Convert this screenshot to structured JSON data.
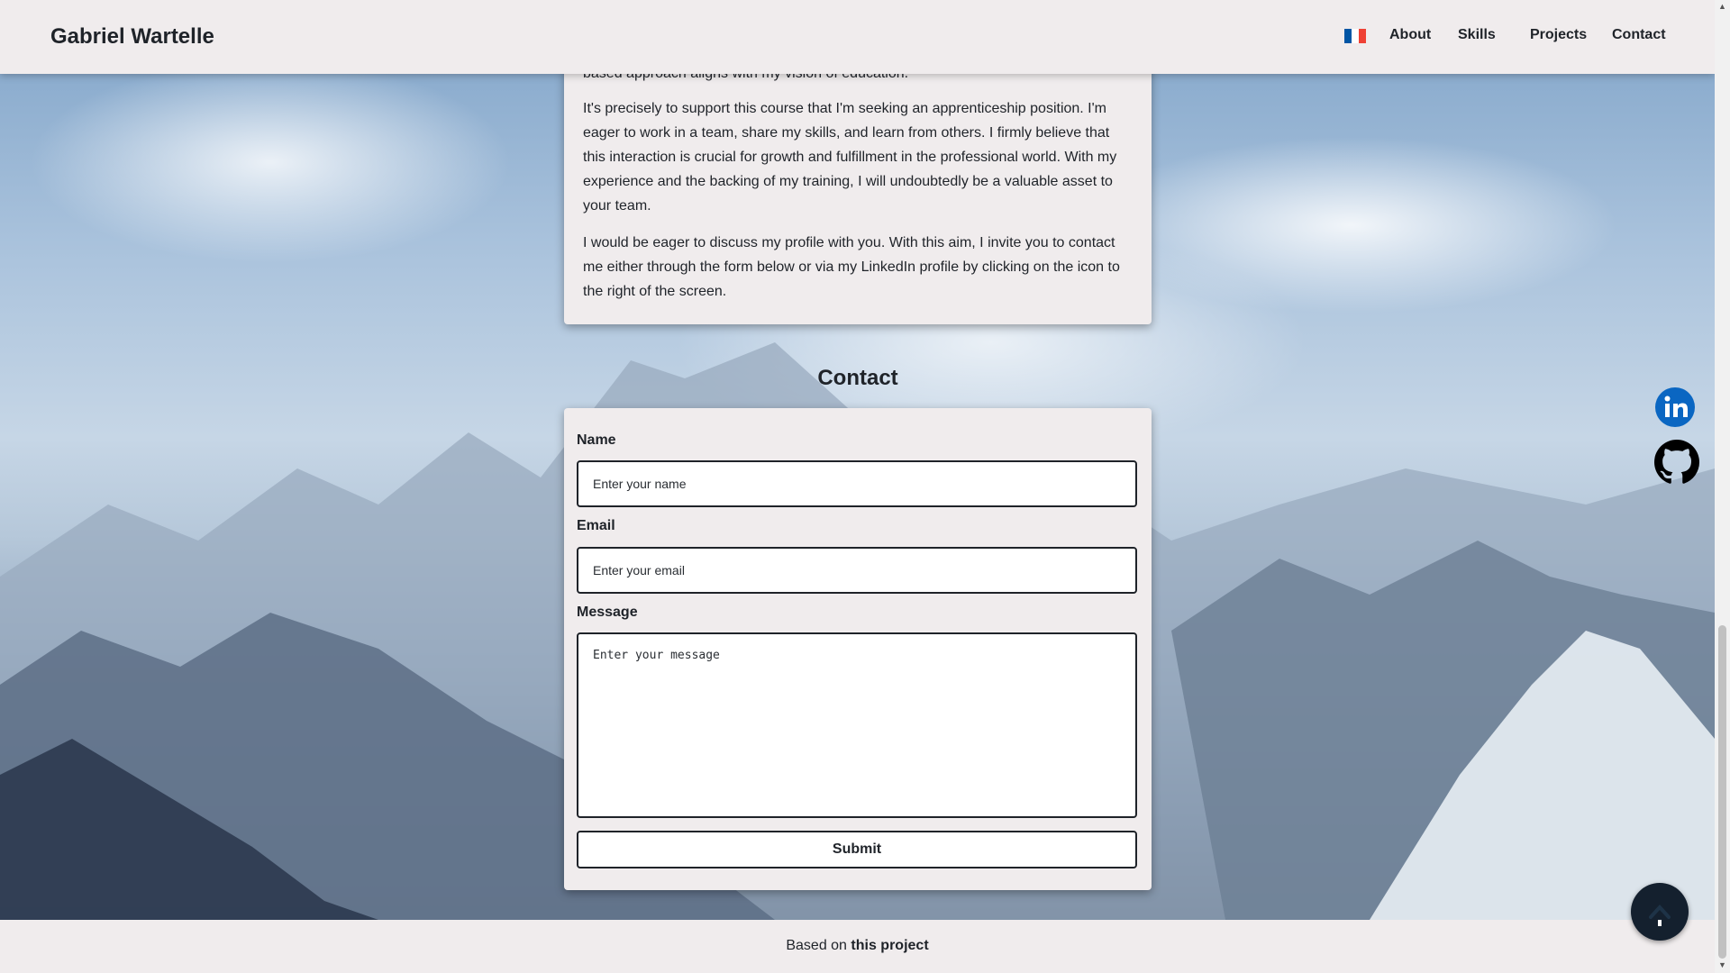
{
  "header": {
    "brand": "Gabriel Wartelle",
    "language_flag": {
      "icon": "french-flag-icon",
      "colors": [
        "#0055a4",
        "#ffffff",
        "#ef4135"
      ]
    },
    "nav": [
      {
        "label": "About"
      },
      {
        "label": "Skills"
      },
      {
        "label": "Projects"
      },
      {
        "label": "Contact"
      }
    ]
  },
  "about": {
    "partial_line": "based approach aligns with my vision of education.",
    "paragraphs": [
      "It's precisely to support this course that I'm seeking an apprenticeship position. I'm eager to work in a team, share my skills, and learn from others. I firmly believe that this interaction is crucial for growth and fulfillment in the professional world. With my experience and the backing of my training, I will undoubtedly be a valuable asset to your team.",
      "I would be eager to discuss my profile with you. With this aim, I invite you to contact me either through the form below or via my LinkedIn profile by clicking on the icon to the right of the screen."
    ]
  },
  "contact": {
    "title": "Contact",
    "name_label": "Name",
    "name_placeholder": "Enter your name",
    "email_label": "Email",
    "email_placeholder": "Enter your email",
    "message_label": "Message",
    "message_placeholder": "Enter your message",
    "submit_label": "Submit"
  },
  "social": {
    "linkedin_icon": "linkedin-icon",
    "linkedin_color": "#0a66c2",
    "github_icon": "github-icon"
  },
  "back_to_top_icon": "arrow-up-icon",
  "footer": {
    "prefix": "Based on ",
    "link_text": "this project"
  }
}
